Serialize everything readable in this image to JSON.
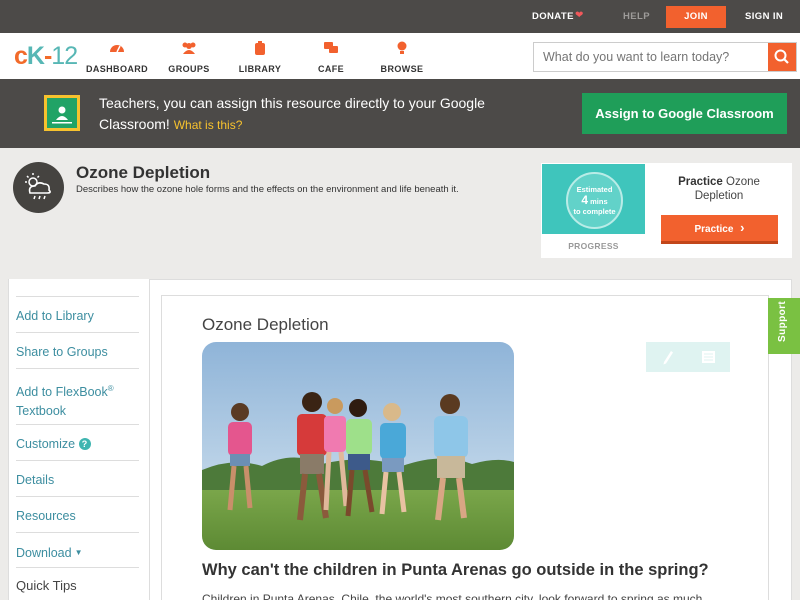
{
  "topbar": {
    "donate": "DONATE",
    "help": "HELP",
    "join": "JOIN",
    "signin": "SIGN IN"
  },
  "logo": {
    "text_c": "c",
    "text_k": "K",
    "text_dash": "-",
    "text_12": "12"
  },
  "nav": {
    "items": [
      {
        "label": "DASHBOARD",
        "icon": "dashboard-icon"
      },
      {
        "label": "GROUPS",
        "icon": "groups-icon"
      },
      {
        "label": "LIBRARY",
        "icon": "library-icon"
      },
      {
        "label": "CAFE",
        "icon": "cafe-icon"
      },
      {
        "label": "BROWSE",
        "icon": "browse-icon"
      }
    ],
    "search_placeholder": "What do you want to learn today?"
  },
  "banner": {
    "message": "Teachers, you can assign this resource directly to your Google Classroom!",
    "what": "What is this?",
    "assign": "Assign to Google Classroom"
  },
  "concept": {
    "title": "Ozone Depletion",
    "description": "Describes how the ozone hole forms and the effects on the environment and life beneath it."
  },
  "practice": {
    "estimated": "Estimated",
    "mins_num": "4",
    "mins_unit": "mins",
    "to_complete": "to complete",
    "progress": "PROGRESS",
    "title_bold": "Practice",
    "title_rest": "Ozone Depletion",
    "button": "Practice"
  },
  "sidebar": {
    "add_library": "Add to Library",
    "share_groups": "Share to Groups",
    "add_flexbook": "Add to FlexBook",
    "reg": "®",
    "textbook": "Textbook",
    "customize": "Customize",
    "details": "Details",
    "resources": "Resources",
    "download": "Download",
    "quick_tips": "Quick Tips"
  },
  "content": {
    "title": "Ozone Depletion",
    "question": "Why can't the children in Punta Arenas go outside in the spring?",
    "paragraph": "Children in Punta Arenas, Chile, the world's most southern city, look forward to spring as much"
  },
  "support": "Support",
  "colors": {
    "accent": "#f2612e",
    "teal": "#3fc5bc",
    "link": "#3d8ea0",
    "green": "#1f9e59"
  }
}
